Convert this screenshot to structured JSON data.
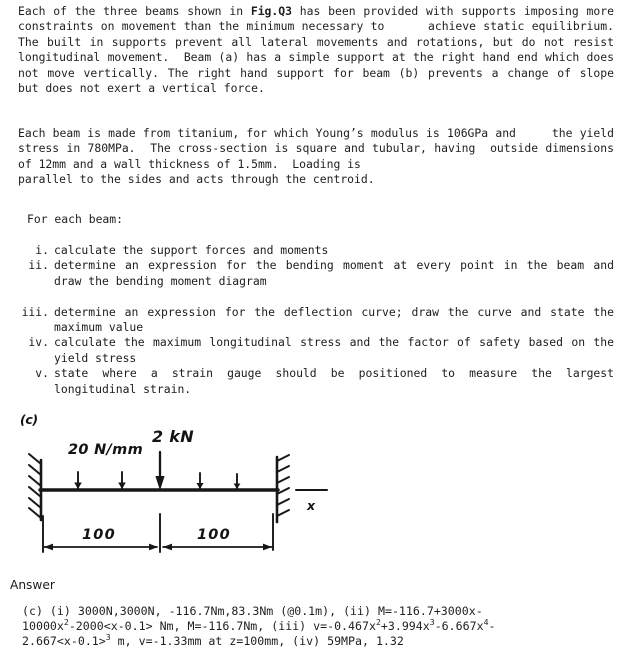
{
  "question": {
    "paragraph_1_pre": "Each of the three beams shown in ",
    "paragraph_1_bold": "Fig.Q3",
    "paragraph_1_post": " has been provided with supports imposing more constraints on movement than the minimum necessary to      achieve static equilibrium.  The built in supports prevent all lateral movements and rotations, but do not resist longitudinal movement.  Beam (a) has a simple support at the right hand end which does not move vertically. The right hand support for beam (b) prevents a change of slope but does not exert a vertical force.",
    "paragraph_2": "Each beam is made from titanium, for which Young’s modulus is 106GPa and     the yield stress in 780MPa.  The cross-section is square and tubular, having  outside dimensions of 12mm and a wall thickness of 1.5mm.  Loading is\nparallel to the sides and acts through the centroid.",
    "for_each_beam": "For each beam:",
    "items": [
      {
        "num": "i.",
        "text": "calculate the support forces and moments"
      },
      {
        "num": "ii.",
        "text": "determine an expression for the bending moment at every point in the beam and draw the bending moment diagram"
      },
      {
        "num": "iii.",
        "text": "determine an expression for the deflection curve; draw the curve and state the maximum value"
      },
      {
        "num": "iv.",
        "text": "calculate the maximum longitudinal stress and the factor of safety based on the yield stress"
      },
      {
        "num": "v.",
        "text": "state where a strain gauge should be positioned to measure the largest longitudinal strain."
      }
    ]
  },
  "figure": {
    "beam_label": "(c)",
    "distributed_load_label": "20 N/mm",
    "point_load_label": "2 kN",
    "axis_label": "x",
    "dimension_left": "100",
    "dimension_right": "100",
    "left_support": "built-in-fixed-support",
    "right_support": "built-in-fixed-support",
    "ink_color": "#171717"
  },
  "answer": {
    "heading": "Answer",
    "line_1_parts": [
      {
        "t": "(c)  (i)  3000N,3000N, -116.7Nm,83.3Nm (@0.1m),  (ii) M=-116.7+3000x-"
      }
    ],
    "line_2_parts": [
      {
        "t": "10000x"
      },
      {
        "sup": "2"
      },
      {
        "t": "-2000<x-0.1> Nm, M=-116.7Nm, (iii) v=-0.467x"
      },
      {
        "sup": "2"
      },
      {
        "t": "+3.994x"
      },
      {
        "sup": "3"
      },
      {
        "t": "-6.667x"
      },
      {
        "sup": "4"
      },
      {
        "t": "-"
      }
    ],
    "line_3_parts": [
      {
        "t": "2.667<x-0.1>"
      },
      {
        "sup": "3"
      },
      {
        "t": " m, v=-1.33mm at z=100mm, (iv) 59MPa, 1.32"
      }
    ],
    "plain_text": "(c)  (i)  3000N,3000N, -116.7Nm,83.3Nm (@0.1m),  (ii) M=-116.7+3000x-10000x^2-2000<x-0.1> Nm, M=-116.7Nm, (iii) v=-0.467x^2+3.994x^3-6.667x^4-2.667<x-0.1>^3 m, v=-1.33mm at z=100mm, (iv) 59MPa, 1.32"
  }
}
